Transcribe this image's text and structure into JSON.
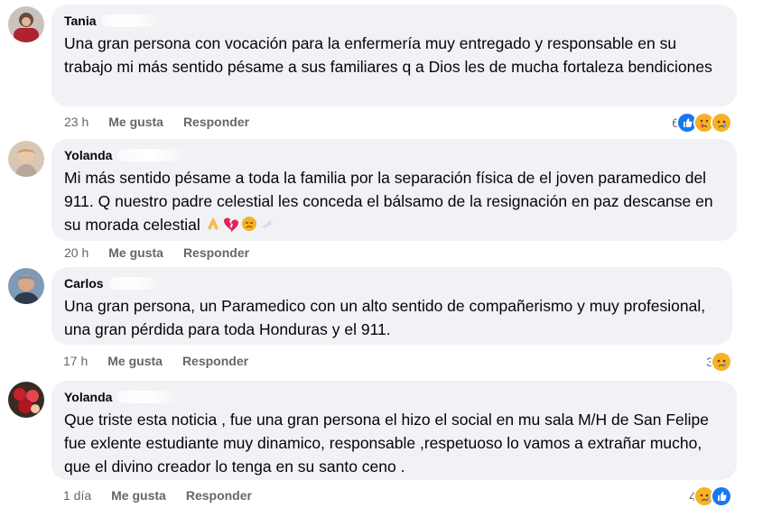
{
  "comments": [
    {
      "author": "Tania",
      "text": "Una gran persona con vocación para la enfermería muy entregado y responsable en su trabajo mi más sentido pésame a sus familiares q a Dios les de mucha fortaleza bendiciones",
      "time": "23 h",
      "like_label": "Me gusta",
      "reply_label": "Responder",
      "reaction_count": "6",
      "reactions": [
        "like-icon",
        "care-icon",
        "sad-icon"
      ]
    },
    {
      "author": "Yolanda",
      "text": "Mi más sentido pésame a toda la familia por la separación física de el joven paramedico del 911. Q nuestro padre celestial les conceda el bálsamo de la resignación en paz descanse en su morada celestial",
      "text_emojis": [
        "praying-hands-icon",
        "broken-heart-icon",
        "sad-face-icon",
        "dove-icon"
      ],
      "time": "20 h",
      "like_label": "Me gusta",
      "reply_label": "Responder"
    },
    {
      "author": "Carlos",
      "text": "Una gran persona, un Paramedico con un alto sentido de compañerismo y muy profesional, una gran pérdida para toda Honduras y el 911.",
      "time": "17 h",
      "like_label": "Me gusta",
      "reply_label": "Responder",
      "reaction_count": "3",
      "reactions": [
        "sad-icon"
      ]
    },
    {
      "author": "Yolanda",
      "text": "Que triste esta noticia , fue una gran persona el hizo el social en mu sala M/H de San Felipe fue exlente estudiante muy dinamico, responsable ,respetuoso lo vamos a extrañar mucho, que el divino creador lo tenga en su santo ceno .",
      "time": "1 día",
      "like_label": "Me gusta",
      "reply_label": "Responder",
      "reaction_count": "4",
      "reactions": [
        "sad-icon",
        "like-icon"
      ]
    }
  ],
  "colors": {
    "bubble": "#f0f2f5",
    "meta": "#65676b",
    "like_blue": "#1877f2",
    "sad_yellow": "#f7b125"
  }
}
